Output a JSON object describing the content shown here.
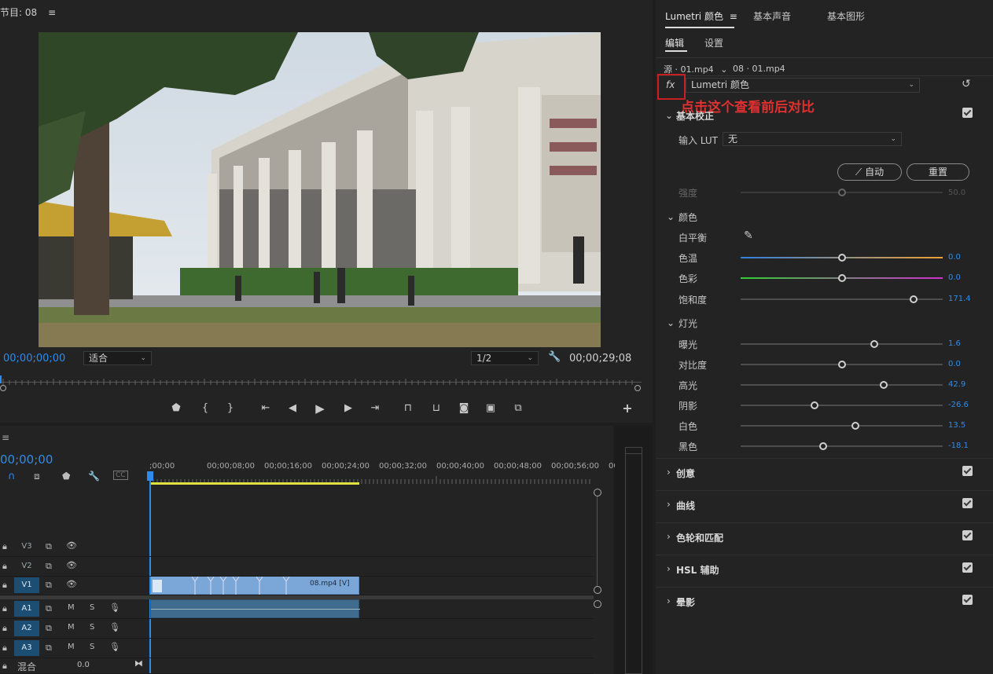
{
  "program": {
    "title": "节目: 08",
    "timecode_left": "00;00;00;00",
    "fit": "适合",
    "resolution": "1/2",
    "timecode_right": "00;00;29;08"
  },
  "transport": {
    "icons": [
      "marker-icon",
      "mark-in-icon",
      "mark-out-icon",
      "go-to-in-icon",
      "step-back-icon",
      "play-icon",
      "step-forward-icon",
      "go-to-out-icon",
      "lift-icon",
      "extract-icon",
      "export-frame-icon",
      "comparison-view-icon",
      "button-editor-icon",
      "add-icon"
    ]
  },
  "timeline": {
    "timecode": "00;00;00",
    "ruler": [
      ";00;00",
      "00;00;08;00",
      "00;00;16;00",
      "00;00;24;00",
      "00;00;32;00",
      "00;00;40;00",
      "00;00;48;00",
      "00;00;56;00",
      "00"
    ],
    "video_tracks": [
      {
        "name": "V3",
        "on": false
      },
      {
        "name": "V2",
        "on": false
      },
      {
        "name": "V1",
        "on": true
      }
    ],
    "audio_tracks": [
      {
        "name": "A1",
        "m": "M",
        "s": "S"
      },
      {
        "name": "A2",
        "m": "M",
        "s": "S"
      },
      {
        "name": "A3",
        "m": "M",
        "s": "S"
      }
    ],
    "clip_label": "08.mp4 [V]",
    "mix_label": "混合",
    "mix_value": "0.0"
  },
  "lumetri": {
    "tabs": [
      "Lumetri 颜色",
      "基本声音",
      "基本图形"
    ],
    "subtabs": [
      "编辑",
      "设置"
    ],
    "source": "源 · 01.mp4",
    "sequence": "08 · 01.mp4",
    "fx": "fx",
    "effect": "Lumetri 颜色",
    "annotation": "点击这个查看前后对比",
    "basic": {
      "title": "基本校正",
      "lut_label": "输入 LUT",
      "lut_value": "无",
      "auto": "自动",
      "reset": "重置",
      "intensity_label": "强度",
      "intensity_value": "50.0"
    },
    "color_section": "颜色",
    "white_balance": "白平衡",
    "color_sliders": [
      {
        "label": "色温",
        "value": "0.0",
        "pos": 0.5
      },
      {
        "label": "色彩",
        "value": "0.0",
        "pos": 0.5
      },
      {
        "label": "饱和度",
        "value": "171.4",
        "pos": 0.857
      }
    ],
    "light_section": "灯光",
    "light_sliders": [
      {
        "label": "曝光",
        "value": "1.6",
        "pos": 0.66
      },
      {
        "label": "对比度",
        "value": "0.0",
        "pos": 0.5
      },
      {
        "label": "高光",
        "value": "42.9",
        "pos": 0.71
      },
      {
        "label": "阴影",
        "value": "-26.6",
        "pos": 0.367
      },
      {
        "label": "白色",
        "value": "13.5",
        "pos": 0.567
      },
      {
        "label": "黑色",
        "value": "-18.1",
        "pos": 0.409
      }
    ],
    "sections": [
      "创意",
      "曲线",
      "色轮和匹配",
      "HSL 辅助",
      "晕影"
    ],
    "colors": {
      "accent": "#2d8ceb",
      "annotation": "#e03030",
      "temp_start": "#2f7fe0",
      "temp_end": "#f0a030",
      "tint_start": "#30d030",
      "tint_end": "#d030d0"
    }
  }
}
